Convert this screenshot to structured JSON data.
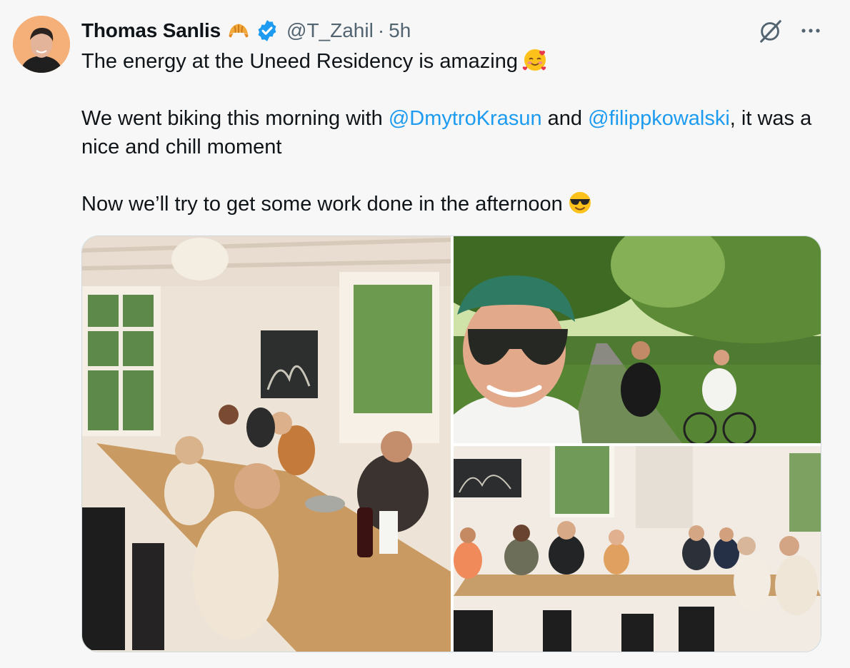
{
  "tweet": {
    "author": {
      "display_name": "Thomas Sanlis",
      "name_emoji": "croissant-icon",
      "verified": true,
      "handle": "@T_Zahil",
      "separator": "·",
      "time": "5h"
    },
    "paragraphs": {
      "p1": {
        "text": "The energy at the Uneed Residency is amazing",
        "emoji": "smiling-face-with-hearts"
      },
      "p2": {
        "part1": "We went biking this morning with ",
        "mention1": "@DmytroKrasun",
        "part2": " and ",
        "mention2": "@filippkowalski",
        "part3": ", it was a nice and chill moment"
      },
      "p3": {
        "text": "Now we’ll try to get some work done in the afternoon",
        "emoji": "smiling-face-with-sunglasses"
      }
    },
    "media": [
      {
        "name": "photo-dining-room-group",
        "alt": ""
      },
      {
        "name": "photo-cycling-selfie",
        "alt": ""
      },
      {
        "name": "photo-dining-table-wide",
        "alt": ""
      }
    ],
    "colors": {
      "link": "#1d9bf0",
      "verified": "#1d9bf0",
      "secondary_text": "#536471"
    }
  }
}
